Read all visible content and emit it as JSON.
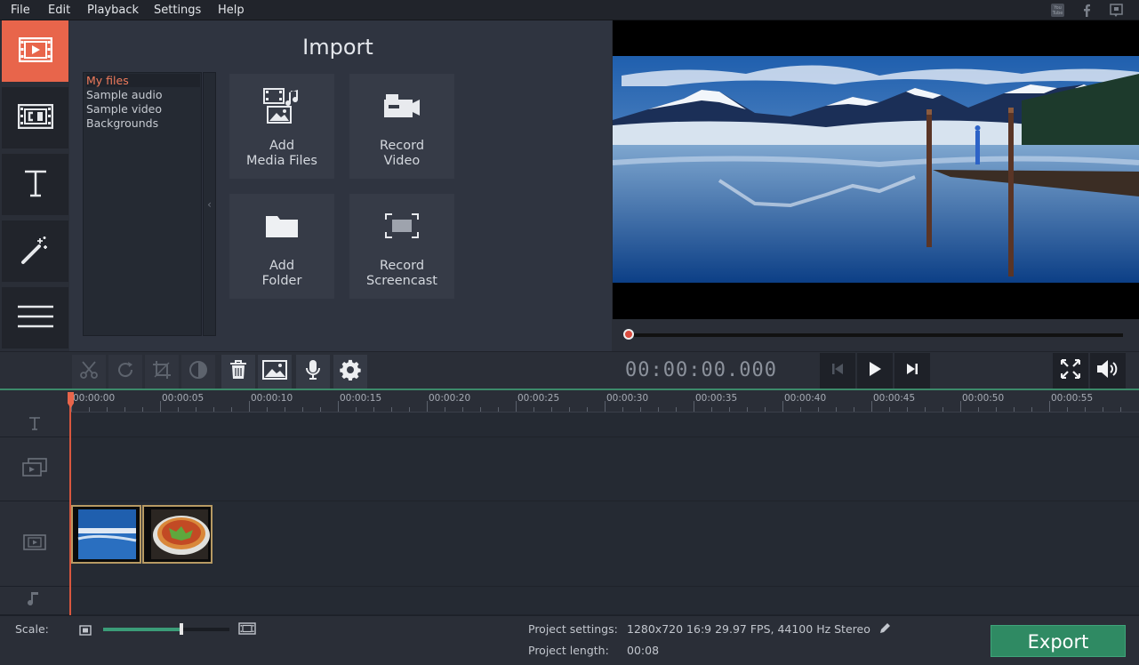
{
  "menu": [
    "File",
    "Edit",
    "Playback",
    "Settings",
    "Help"
  ],
  "social_icons": [
    "youtube-icon",
    "facebook-icon",
    "share-icon"
  ],
  "nav": [
    {
      "name": "import-tab",
      "icon": "film-import-icon",
      "active": true
    },
    {
      "name": "filters-tab",
      "icon": "filmstrip-icon",
      "active": false
    },
    {
      "name": "titles-tab",
      "icon": "text-icon",
      "active": false
    },
    {
      "name": "effects-tab",
      "icon": "magic-wand-icon",
      "active": false
    },
    {
      "name": "more-tab",
      "icon": "menu-icon",
      "active": false
    }
  ],
  "import": {
    "title": "Import",
    "files": [
      "My files",
      "Sample audio",
      "Sample video",
      "Backgrounds"
    ],
    "selected_file": "My files",
    "collapse_glyph": "‹",
    "tiles": [
      {
        "label": "Add\nMedia Files",
        "icon": "media-files-icon"
      },
      {
        "label": "Record\nVideo",
        "icon": "camera-icon"
      },
      {
        "label": "Add\nFolder",
        "icon": "folder-icon"
      },
      {
        "label": "Record\nScreencast",
        "icon": "screencast-icon"
      }
    ]
  },
  "toolbar": {
    "tools": [
      {
        "icon": "scissors-icon",
        "enabled": false
      },
      {
        "icon": "rotate-icon",
        "enabled": false
      },
      {
        "icon": "crop-icon",
        "enabled": false
      },
      {
        "icon": "color-adjust-icon",
        "enabled": false
      },
      {
        "icon": "trash-icon",
        "enabled": true
      },
      {
        "icon": "image-icon",
        "enabled": true
      },
      {
        "icon": "microphone-icon",
        "enabled": true
      },
      {
        "icon": "gear-icon",
        "enabled": true
      }
    ],
    "timecode": "00:00:00.000"
  },
  "playback": {
    "position": 0,
    "buttons": [
      "skip-back-icon",
      "play-icon",
      "skip-forward-icon"
    ],
    "right_buttons": [
      "fullscreen-icon",
      "volume-icon"
    ]
  },
  "timeline": {
    "ticks": [
      "00:00:00",
      "00:00:05",
      "00:00:10",
      "00:00:15",
      "00:00:20",
      "00:00:25",
      "00:00:30",
      "00:00:35",
      "00:00:40",
      "00:00:45",
      "00:00:50",
      "00:00:55"
    ],
    "track_icons": [
      "text-track-icon",
      "overlay-track-icon",
      "video-track-icon",
      "audio-track-icon"
    ],
    "clips": [
      "lake-mountains-clip",
      "pizza-clip"
    ]
  },
  "status": {
    "scale_label": "Scale:",
    "scale_value": 0.62,
    "settings_label": "Project settings:",
    "settings_value": "1280x720 16:9 29.97 FPS, 44100 Hz Stereo",
    "length_label": "Project length:",
    "length_value": "00:08",
    "export_label": "Export"
  },
  "colors": {
    "accent": "#e8654b",
    "export": "#2f8a63",
    "timeline_bar": "#3c8a6a"
  }
}
